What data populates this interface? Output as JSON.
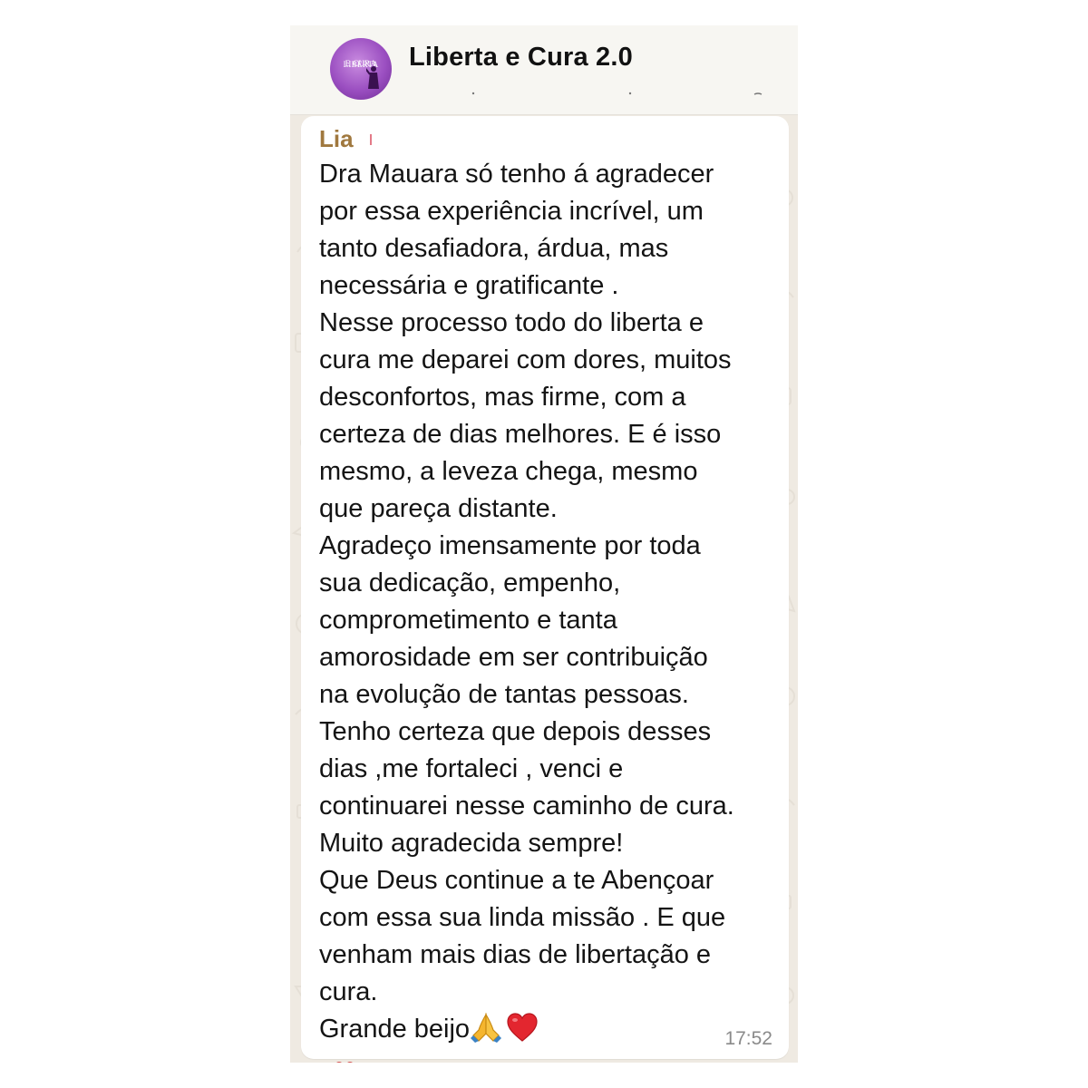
{
  "chat_header": {
    "group_name": "Liberta e Cura 2.0",
    "avatar_text_line1": "LIBERTA",
    "avatar_text_line2": "E CURA"
  },
  "message": {
    "sender": "Lia",
    "body": "Dra Mauara só tenho á agradecer\npor essa experiência incrível, um\ntanto desafiadora, árdua, mas\nnecessária e gratificante .\nNesse processo todo do liberta e\ncura me deparei com dores, muitos\ndesconfortos, mas firme, com a\ncerteza de dias melhores. E é isso\nmesmo, a leveza chega, mesmo\nque pareça distante.\nAgradeço imensamente por toda\nsua dedicação, empenho,\ncomprometimento e tanta\namorosidade em ser contribuição\nna evolução de tantas pessoas.\nTenho certeza que depois desses\ndias ,me fortaleci , venci e\ncontinuarei nesse caminho de cura.\nMuito agradecida sempre!\nQue Deus continue a te Abençoar\ncom essa sua linda missão . E que\nvenham mais dias de libertação e\ncura.",
    "closing": "Grande beijo",
    "emojis": [
      "folded-hands",
      "red-heart"
    ],
    "time": "17:52"
  },
  "colors": {
    "sender_name": "#a0783e",
    "chat_background": "#efeae2",
    "bubble": "#ffffff",
    "timestamp": "#8a8a8a"
  }
}
